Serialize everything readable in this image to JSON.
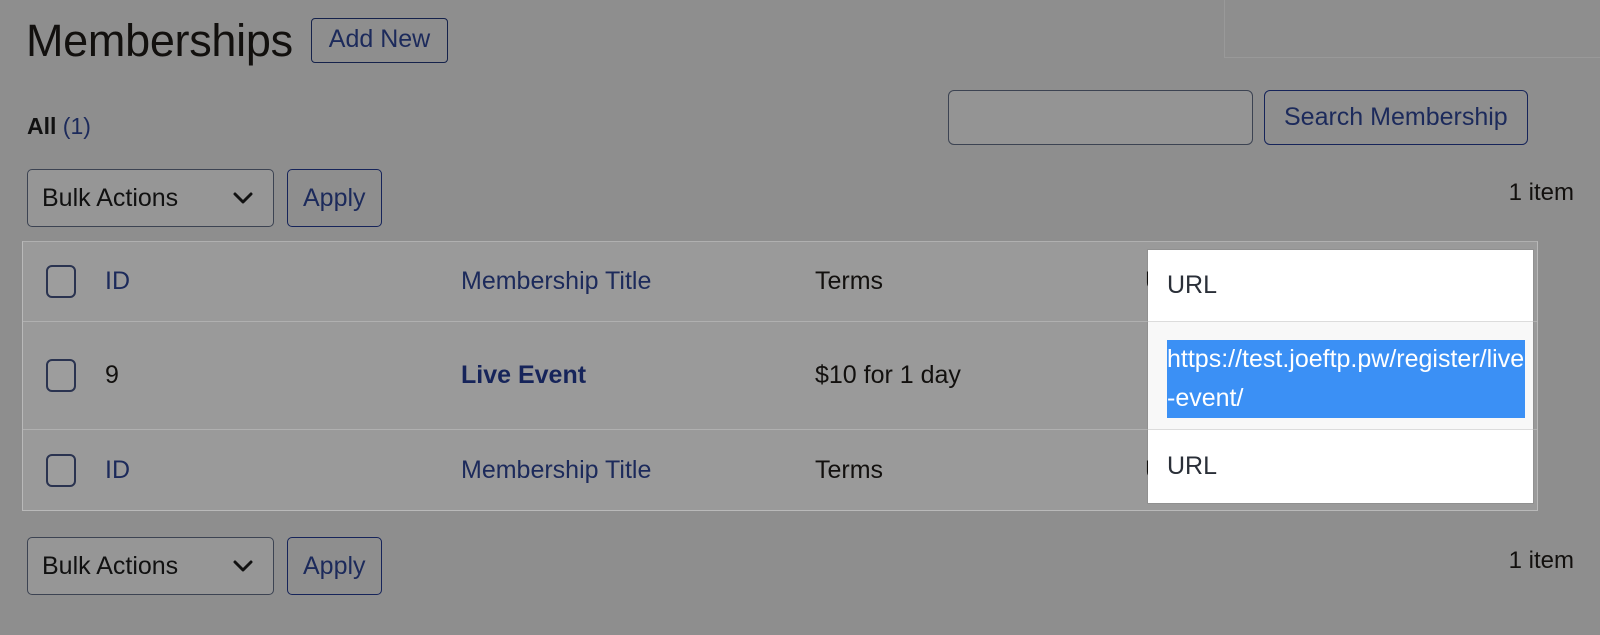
{
  "header": {
    "title": "Memberships",
    "add_new_label": "Add New"
  },
  "filters": {
    "all_label": "All",
    "all_count": "(1)"
  },
  "search": {
    "value": "",
    "placeholder": "",
    "button_label": "Search Membership"
  },
  "tablenav_top": {
    "bulk_actions_label": "Bulk Actions",
    "apply_label": "Apply",
    "item_count": "1 item"
  },
  "tablenav_bottom": {
    "bulk_actions_label": "Bulk Actions",
    "apply_label": "Apply",
    "item_count": "1 item"
  },
  "table": {
    "columns": {
      "id": "ID",
      "title": "Membership Title",
      "terms": "Terms",
      "url": "URL"
    },
    "footer_columns": {
      "id": "ID",
      "title": "Membership Title",
      "terms": "Terms",
      "url": "URL"
    },
    "rows": [
      {
        "id": "9",
        "title": "Live Event",
        "terms": "$10 for 1 day",
        "url": "https://test.joeftp.pw/register/live-event/"
      }
    ]
  },
  "colors": {
    "page_background": "#8e8e8e",
    "table_background": "#9a9a9a",
    "link": "#1c2a5b",
    "selection_highlight": "#3b90f5",
    "panel_background": "#ffffff"
  }
}
